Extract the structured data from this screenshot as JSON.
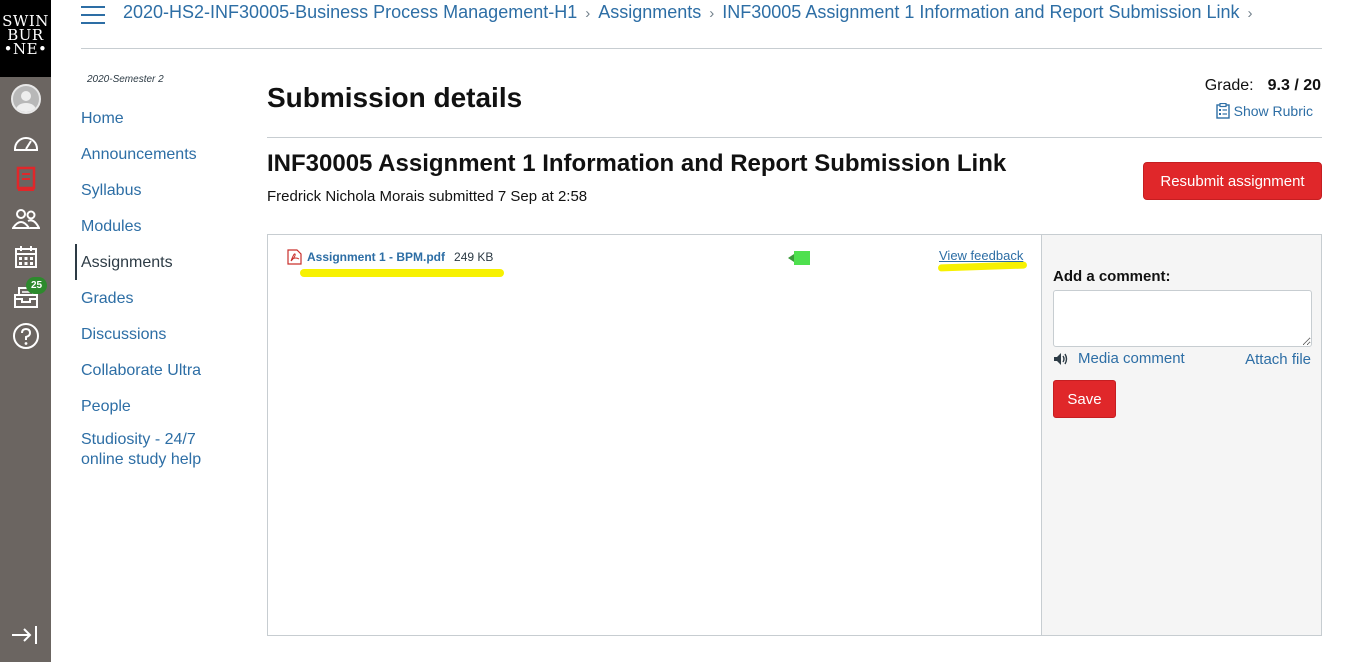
{
  "global_nav": {
    "logo_lines": [
      "SWIN",
      "BUR",
      "•NE•"
    ],
    "items": [
      {
        "icon": "account-icon"
      },
      {
        "icon": "dashboard-icon"
      },
      {
        "icon": "courses-icon"
      },
      {
        "icon": "groups-icon"
      },
      {
        "icon": "calendar-icon"
      },
      {
        "icon": "inbox-icon",
        "badge": "25"
      },
      {
        "icon": "help-icon"
      }
    ],
    "collapse_icon": "collapse-nav-icon"
  },
  "breadcrumb": {
    "items": [
      "2020-HS2-INF30005-Business Process Management-H1",
      "Assignments",
      "INF30005 Assignment 1 Information and Report Submission Link"
    ],
    "separator": "›"
  },
  "course_nav": {
    "term": "2020-Semester 2",
    "items": [
      {
        "label": "Home"
      },
      {
        "label": "Announcements"
      },
      {
        "label": "Syllabus"
      },
      {
        "label": "Modules"
      },
      {
        "label": "Assignments",
        "active": true
      },
      {
        "label": "Grades"
      },
      {
        "label": "Discussions"
      },
      {
        "label": "Collaborate Ultra"
      },
      {
        "label": "People"
      },
      {
        "label": "Studiosity - 24/7 online study help"
      }
    ]
  },
  "main": {
    "page_title": "Submission details",
    "grade_label": "Grade:",
    "grade_value": "9.3 / 20",
    "show_rubric": "Show Rubric",
    "assignment_title": "INF30005 Assignment 1 Information and Report Submission Link",
    "submitted_text": "Fredrick Nichola Morais submitted 7 Sep at 2:58",
    "resubmit_label": "Resubmit assignment"
  },
  "submission": {
    "file_name": "Assignment 1 - BPM.pdf",
    "file_size": "249 KB",
    "view_feedback": "View feedback",
    "file_icon": "pdf-icon",
    "highlight_color": "#f7f101"
  },
  "comments": {
    "label": "Add a comment:",
    "media_comment": "Media comment",
    "attach_file": "Attach file",
    "save_label": "Save"
  },
  "colors": {
    "link": "#2d6ea5",
    "primary_button": "#e0272a",
    "global_nav_bg": "#6b6561",
    "badge": "#2d8a2d"
  }
}
